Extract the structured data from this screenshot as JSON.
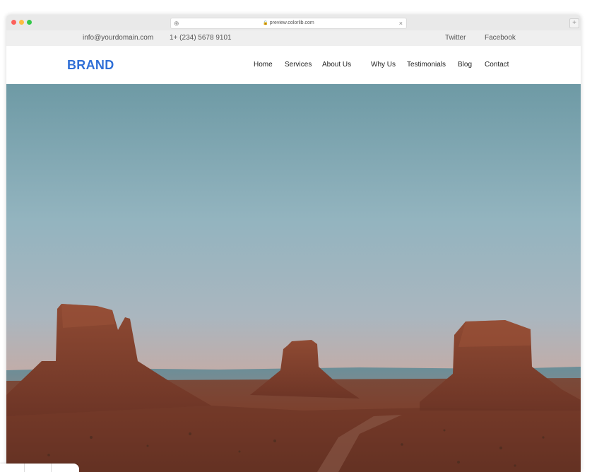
{
  "browser": {
    "url": "preview.colorlib.com",
    "new_tab_label": "+",
    "close_label": "×"
  },
  "topbar": {
    "email": "info@yourdomain.com",
    "phone": "1+ (234) 5678 9101",
    "twitter": "Twitter",
    "facebook": "Facebook"
  },
  "header": {
    "brand": "BRAND",
    "brand_color": "#2f6fd7",
    "nav": [
      "Home",
      "Services",
      "About Us",
      "Why Us",
      "Testimonials",
      "Blog",
      "Contact"
    ]
  },
  "hero": {
    "image": "desert-buttes-landscape",
    "colors": {
      "sky_top": "#6f9ba6",
      "sky_bottom": "#c9aaa0",
      "rock": "#8a4530",
      "ground": "#6e3a28"
    }
  }
}
